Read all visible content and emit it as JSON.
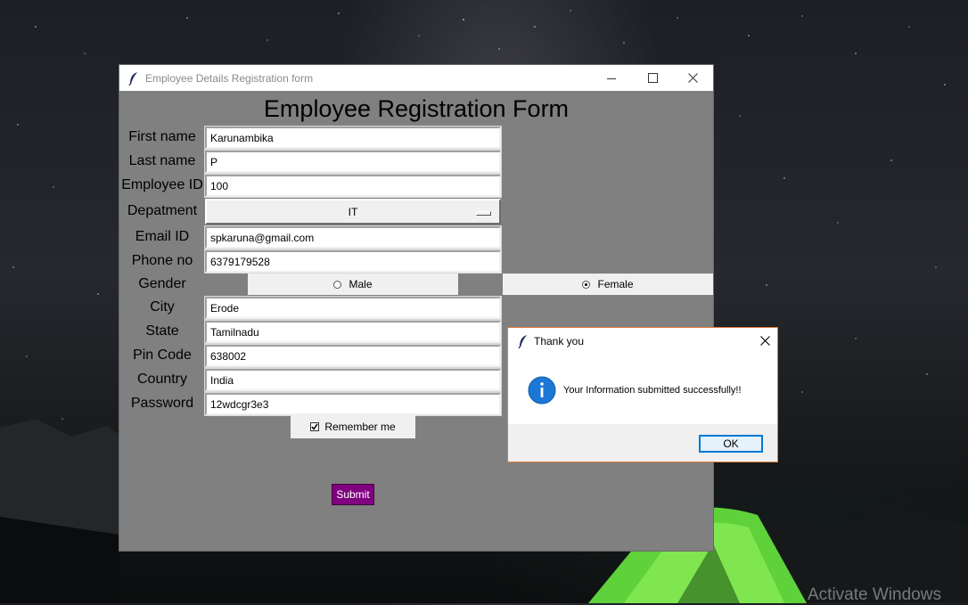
{
  "main_window": {
    "title": "Employee Details Registration form",
    "heading": "Employee Registration Form",
    "fields": [
      {
        "label": "First name",
        "value": "Karunambika"
      },
      {
        "label": "Last name",
        "value": "P"
      },
      {
        "label": "Employee ID",
        "value": "100"
      },
      {
        "label": "Email ID",
        "value": "spkaruna@gmail.com"
      },
      {
        "label": "Phone no",
        "value": "6379179528"
      },
      {
        "label": "City",
        "value": "Erode"
      },
      {
        "label": "State",
        "value": "Tamilnadu"
      },
      {
        "label": "Pin Code",
        "value": "638002"
      },
      {
        "label": "Country",
        "value": "India"
      },
      {
        "label": "Password",
        "value": "12wdcgr3e3"
      }
    ],
    "department": {
      "label": "Depatment",
      "selected": "IT"
    },
    "gender": {
      "label": "Gender",
      "options": [
        "Male",
        "Female"
      ],
      "selected": "Female"
    },
    "remember": {
      "label": "Remember me",
      "checked": true
    },
    "submit_label": "Submit",
    "background_color": "#808080",
    "submit_color": "#800080"
  },
  "dialog": {
    "title": "Thank you",
    "message": "Your Information submitted successfully!!",
    "ok_label": "OK",
    "icon": "info-icon"
  },
  "desktop": {
    "watermark": "Activate Windows"
  }
}
